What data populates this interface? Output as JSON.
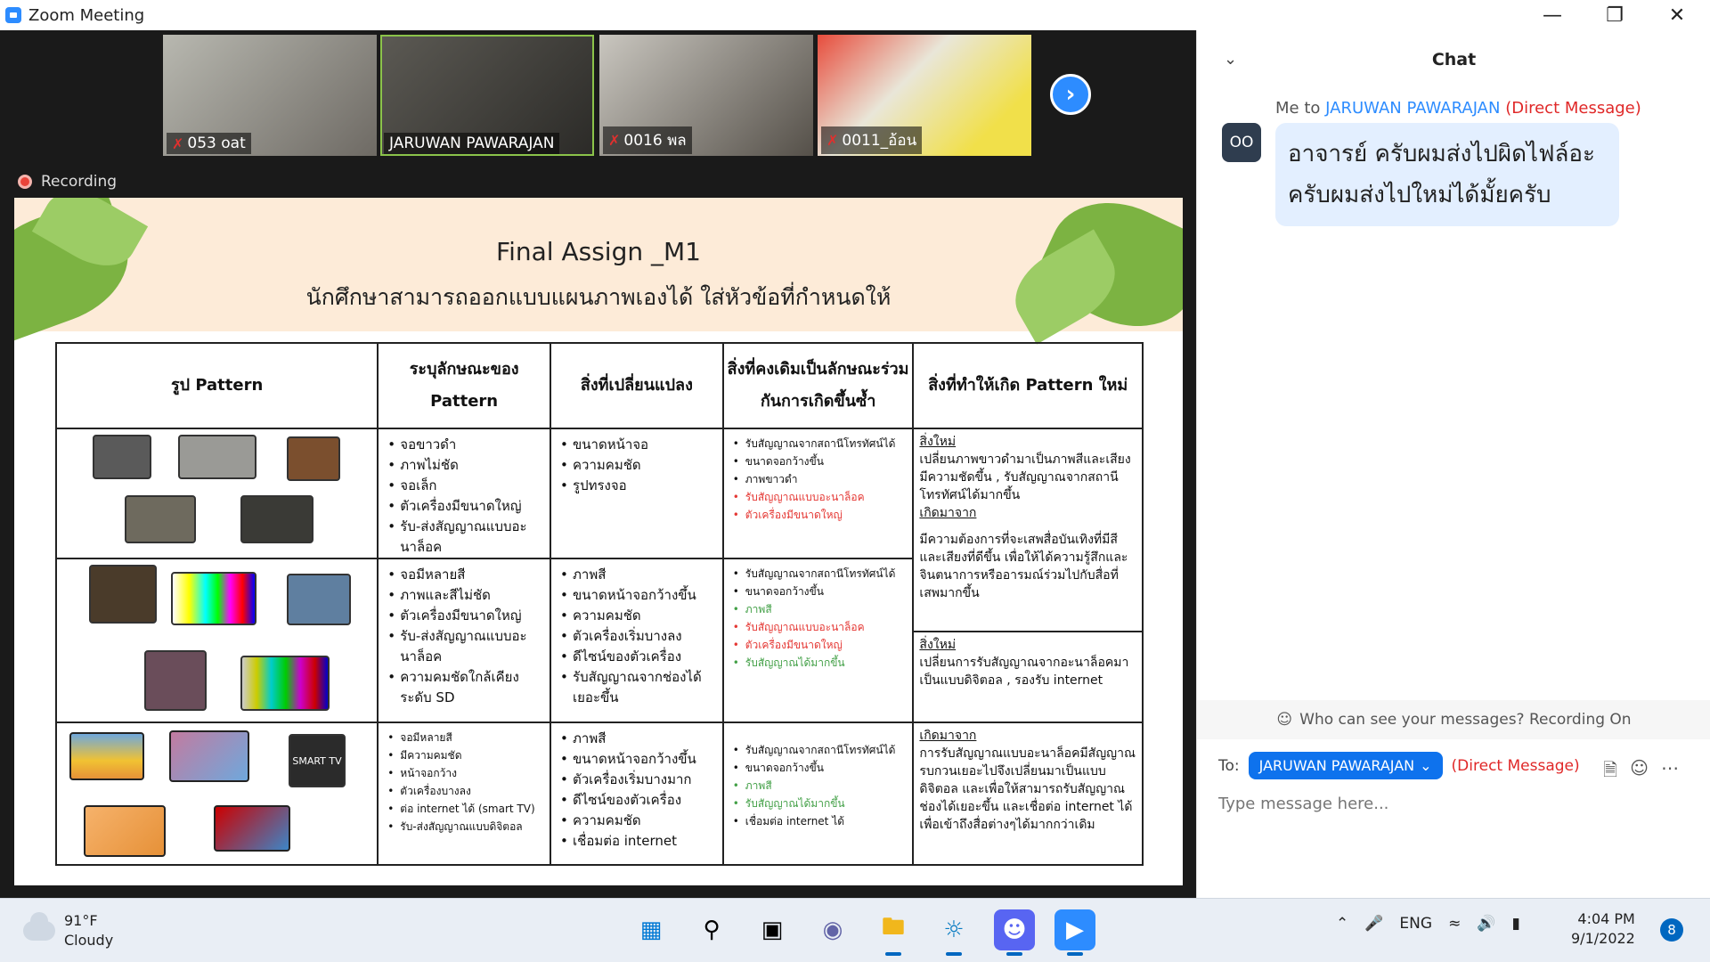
{
  "window": {
    "title": "Zoom Meeting"
  },
  "participants": [
    {
      "name": "053 oat",
      "muted": true
    },
    {
      "name": "JARUWAN PAWARAJAN",
      "muted": false,
      "active": true
    },
    {
      "name": "0016 พล",
      "muted": true
    },
    {
      "name": "0011_อ้อน",
      "muted": true
    }
  ],
  "recording_label": "Recording",
  "slide": {
    "title": "Final Assign _M1",
    "subtitle": "นักศึกษาสามารถออกแบบแผนภาพเองได้ ใส่หัวข้อที่กำหนดให้",
    "headers": [
      "รูป Pattern",
      "ระบุลักษณะของ Pattern",
      "สิ่งที่เปลี่ยนแปลง",
      "สิ่งที่คงเดิมเป็นลักษณะร่วม กันการเกิดขึ้นซ้ำ",
      "สิ่งที่ทำให้เกิด Pattern ใหม่"
    ],
    "rows": [
      {
        "traits": [
          "จอขาวดำ",
          "ภาพไม่ชัด",
          "จอเล็ก",
          "ตัวเครื่องมีขนาดใหญ่",
          "รับ-ส่งสัญญาณแบบอะนาล็อค"
        ],
        "changes": [
          "ขนาดหน้าจอ",
          "ความคมชัด",
          "รูปทรงจอ"
        ],
        "common": [
          {
            "text": "รับสัญญาณจากสถานีโทรทัศน์ได้",
            "color": "black"
          },
          {
            "text": "ขนาดจอกว้างขึ้น",
            "color": "black"
          },
          {
            "text": "ภาพขาวดำ",
            "color": "black"
          },
          {
            "text": "รับสัญญาณแบบอะนาล็อค",
            "color": "red"
          },
          {
            "text": "ตัวเครื่องมีขนาดใหญ่",
            "color": "red"
          }
        ]
      },
      {
        "traits": [
          "จอมีหลายสี",
          "ภาพและสีไม่ชัด",
          "ตัวเครื่องมีขนาดใหญ่",
          "รับ-ส่งสัญญาณแบบอะนาล็อค",
          "ความคมชัดใกล้เคียงระดับ SD"
        ],
        "changes": [
          "ภาพสี",
          "ขนาดหน้าจอกว้างขึ้น",
          "ความคมชัด",
          "ตัวเครื่องเริ่มบางลง",
          "ดีไซน์ของตัวเครื่อง",
          "รับสัญญาณจากช่องได้เยอะขึ้น"
        ],
        "common": [
          {
            "text": "รับสัญญาณจากสถานีโทรทัศน์ได้",
            "color": "black"
          },
          {
            "text": "ขนาดจอกว้างขึ้น",
            "color": "black"
          },
          {
            "text": "ภาพสี",
            "color": "green"
          },
          {
            "text": "รับสัญญาณแบบอะนาล็อค",
            "color": "red"
          },
          {
            "text": "ตัวเครื่องมีขนาดใหญ่",
            "color": "red"
          },
          {
            "text": "รับสัญญาณได้มากขึ้น",
            "color": "green"
          }
        ]
      },
      {
        "traits": [
          "จอมีหลายสี",
          "มีความคมชัด",
          "หน้าจอกว้าง",
          "ตัวเครื่องบางลง",
          "ต่อ internet ได้ (smart TV)",
          "รับ-ส่งสัญญาณแบบดิจิตอล"
        ],
        "changes": [
          "ภาพสี",
          "ขนาดหน้าจอกว้างขึ้น",
          "ตัวเครื่องเริ่มบางมาก",
          "ดีไซน์ของตัวเครื่อง",
          "ความคมชัด",
          "เชื่อมต่อ internet"
        ],
        "common": [
          {
            "text": "รับสัญญาณจากสถานีโทรทัศน์ได้",
            "color": "black"
          },
          {
            "text": "ขนาดจอกว้างขึ้น",
            "color": "black"
          },
          {
            "text": "ภาพสี",
            "color": "green"
          },
          {
            "text": "รับสัญญาณได้มากขึ้น",
            "color": "green"
          },
          {
            "text": "เชื่อมต่อ internet ได้",
            "color": "black"
          }
        ]
      }
    ],
    "new_pattern": {
      "new_label_1": "สิ่งใหม่",
      "new_text_1": "เปลี่ยนภาพขาวดำมาเป็นภาพสีและเสียงมีความชัดขึ้น , รับสัญญาณจากสถานีโทรทัศน์ได้มากขึ้น",
      "cause_label_1": "เกิดมาจาก",
      "cause_text_1": "มีความต้องการที่จะเสพสื่อบันเทิงที่มีสีและเสียงที่ดีขึ้น เพื่อให้ได้ความรู้สึกและจินตนาการหรืออารมณ์ร่วมไปกับสื่อที่เสพมากขึ้น",
      "new_label_2": "สิ่งใหม่",
      "new_text_2": "เปลี่ยนการรับสัญญาณจากอะนาล็อคมาเป็นแบบดิจิตอล , รองรับ internet",
      "cause_label_2": "เกิดมาจาก",
      "cause_text_2": "การรับสัญญาณแบบอะนาล็อคมีสัญญาณรบกวนเยอะไปจึงเปลี่ยนมาเป็นแบบดิจิตอล และเพื่อให้สามารถรับสัญญาณช่องได้เยอะขึ้น และเชื่อต่อ internet ได้เพื่อเข้าถึงสื่อต่างๆได้มากกว่าเดิม"
    }
  },
  "chat": {
    "header": "Chat",
    "meta_prefix": "Me to",
    "meta_to": "JARUWAN PAWARAJAN",
    "meta_dm": "(Direct Message)",
    "avatar_initials": "OO",
    "message": "อาจารย์ ครับผมส่งไปผิดไฟล์อะครับผมส่งไปใหม่ได้มั้ยครับ",
    "privacy": "Who can see your messages? Recording On",
    "to_label": "To:",
    "to_value": "JARUWAN PAWARAJAN",
    "to_dm": "(Direct Message)",
    "placeholder": "Type message here..."
  },
  "taskbar": {
    "temp": "91°F",
    "condition": "Cloudy",
    "lang": "ENG",
    "time": "4:04 PM",
    "date": "9/1/2022",
    "notifications": "8"
  }
}
